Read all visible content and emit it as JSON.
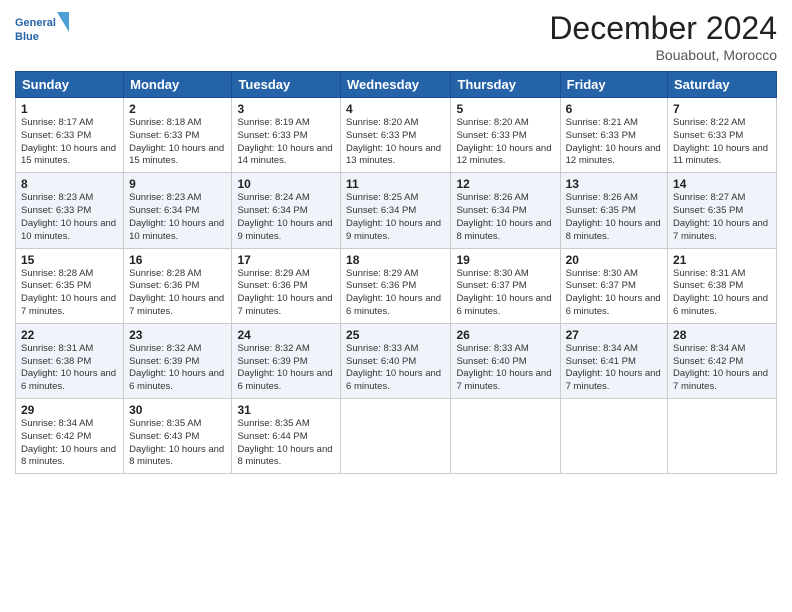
{
  "logo": {
    "line1": "General",
    "line2": "Blue"
  },
  "title": "December 2024",
  "location": "Bouabout, Morocco",
  "headers": [
    "Sunday",
    "Monday",
    "Tuesday",
    "Wednesday",
    "Thursday",
    "Friday",
    "Saturday"
  ],
  "weeks": [
    [
      {
        "day": "1",
        "sunrise": "8:17 AM",
        "sunset": "6:33 PM",
        "daylight": "10 hours and 15 minutes."
      },
      {
        "day": "2",
        "sunrise": "8:18 AM",
        "sunset": "6:33 PM",
        "daylight": "10 hours and 15 minutes."
      },
      {
        "day": "3",
        "sunrise": "8:19 AM",
        "sunset": "6:33 PM",
        "daylight": "10 hours and 14 minutes."
      },
      {
        "day": "4",
        "sunrise": "8:20 AM",
        "sunset": "6:33 PM",
        "daylight": "10 hours and 13 minutes."
      },
      {
        "day": "5",
        "sunrise": "8:20 AM",
        "sunset": "6:33 PM",
        "daylight": "10 hours and 12 minutes."
      },
      {
        "day": "6",
        "sunrise": "8:21 AM",
        "sunset": "6:33 PM",
        "daylight": "10 hours and 12 minutes."
      },
      {
        "day": "7",
        "sunrise": "8:22 AM",
        "sunset": "6:33 PM",
        "daylight": "10 hours and 11 minutes."
      }
    ],
    [
      {
        "day": "8",
        "sunrise": "8:23 AM",
        "sunset": "6:33 PM",
        "daylight": "10 hours and 10 minutes."
      },
      {
        "day": "9",
        "sunrise": "8:23 AM",
        "sunset": "6:34 PM",
        "daylight": "10 hours and 10 minutes."
      },
      {
        "day": "10",
        "sunrise": "8:24 AM",
        "sunset": "6:34 PM",
        "daylight": "10 hours and 9 minutes."
      },
      {
        "day": "11",
        "sunrise": "8:25 AM",
        "sunset": "6:34 PM",
        "daylight": "10 hours and 9 minutes."
      },
      {
        "day": "12",
        "sunrise": "8:26 AM",
        "sunset": "6:34 PM",
        "daylight": "10 hours and 8 minutes."
      },
      {
        "day": "13",
        "sunrise": "8:26 AM",
        "sunset": "6:35 PM",
        "daylight": "10 hours and 8 minutes."
      },
      {
        "day": "14",
        "sunrise": "8:27 AM",
        "sunset": "6:35 PM",
        "daylight": "10 hours and 7 minutes."
      }
    ],
    [
      {
        "day": "15",
        "sunrise": "8:28 AM",
        "sunset": "6:35 PM",
        "daylight": "10 hours and 7 minutes."
      },
      {
        "day": "16",
        "sunrise": "8:28 AM",
        "sunset": "6:36 PM",
        "daylight": "10 hours and 7 minutes."
      },
      {
        "day": "17",
        "sunrise": "8:29 AM",
        "sunset": "6:36 PM",
        "daylight": "10 hours and 7 minutes."
      },
      {
        "day": "18",
        "sunrise": "8:29 AM",
        "sunset": "6:36 PM",
        "daylight": "10 hours and 6 minutes."
      },
      {
        "day": "19",
        "sunrise": "8:30 AM",
        "sunset": "6:37 PM",
        "daylight": "10 hours and 6 minutes."
      },
      {
        "day": "20",
        "sunrise": "8:30 AM",
        "sunset": "6:37 PM",
        "daylight": "10 hours and 6 minutes."
      },
      {
        "day": "21",
        "sunrise": "8:31 AM",
        "sunset": "6:38 PM",
        "daylight": "10 hours and 6 minutes."
      }
    ],
    [
      {
        "day": "22",
        "sunrise": "8:31 AM",
        "sunset": "6:38 PM",
        "daylight": "10 hours and 6 minutes."
      },
      {
        "day": "23",
        "sunrise": "8:32 AM",
        "sunset": "6:39 PM",
        "daylight": "10 hours and 6 minutes."
      },
      {
        "day": "24",
        "sunrise": "8:32 AM",
        "sunset": "6:39 PM",
        "daylight": "10 hours and 6 minutes."
      },
      {
        "day": "25",
        "sunrise": "8:33 AM",
        "sunset": "6:40 PM",
        "daylight": "10 hours and 6 minutes."
      },
      {
        "day": "26",
        "sunrise": "8:33 AM",
        "sunset": "6:40 PM",
        "daylight": "10 hours and 7 minutes."
      },
      {
        "day": "27",
        "sunrise": "8:34 AM",
        "sunset": "6:41 PM",
        "daylight": "10 hours and 7 minutes."
      },
      {
        "day": "28",
        "sunrise": "8:34 AM",
        "sunset": "6:42 PM",
        "daylight": "10 hours and 7 minutes."
      }
    ],
    [
      {
        "day": "29",
        "sunrise": "8:34 AM",
        "sunset": "6:42 PM",
        "daylight": "10 hours and 8 minutes."
      },
      {
        "day": "30",
        "sunrise": "8:35 AM",
        "sunset": "6:43 PM",
        "daylight": "10 hours and 8 minutes."
      },
      {
        "day": "31",
        "sunrise": "8:35 AM",
        "sunset": "6:44 PM",
        "daylight": "10 hours and 8 minutes."
      },
      null,
      null,
      null,
      null
    ]
  ]
}
